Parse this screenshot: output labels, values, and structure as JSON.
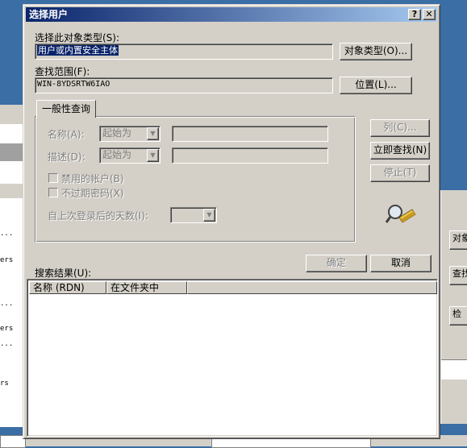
{
  "dialog": {
    "title": "选择用户",
    "help_btn": "?",
    "close_btn": "✕"
  },
  "object_type": {
    "label": "选择此对象类型(S):",
    "value": "用户或内置安全主体",
    "button": "对象类型(O)..."
  },
  "location": {
    "label": "查找范围(F):",
    "value": "WIN-8YDSRTW6IAO",
    "button": "位置(L)..."
  },
  "general_query": {
    "tab": "一般性查询",
    "name_label": "名称(A):",
    "name_mode": "起始为",
    "desc_label": "描述(D):",
    "desc_mode": "起始为",
    "disabled_accounts": "禁用的帐户(B)",
    "non_expiring_pw": "不过期密码(X)",
    "days_since_logon": "自上次登录后的天数(I):"
  },
  "actions": {
    "columns": "列(C)...",
    "find_now": "立即查找(N)",
    "stop": "停止(T)",
    "ok": "确定",
    "cancel": "取消"
  },
  "results": {
    "label": "搜索结果(U):",
    "columns": [
      "名称 (RDN)",
      "在文件夹中"
    ]
  },
  "background": {
    "left_items": [
      "...",
      "ers",
      "...",
      "ers",
      "...",
      "rs"
    ],
    "right_buttons": [
      "对象",
      "查找",
      "检"
    ]
  }
}
